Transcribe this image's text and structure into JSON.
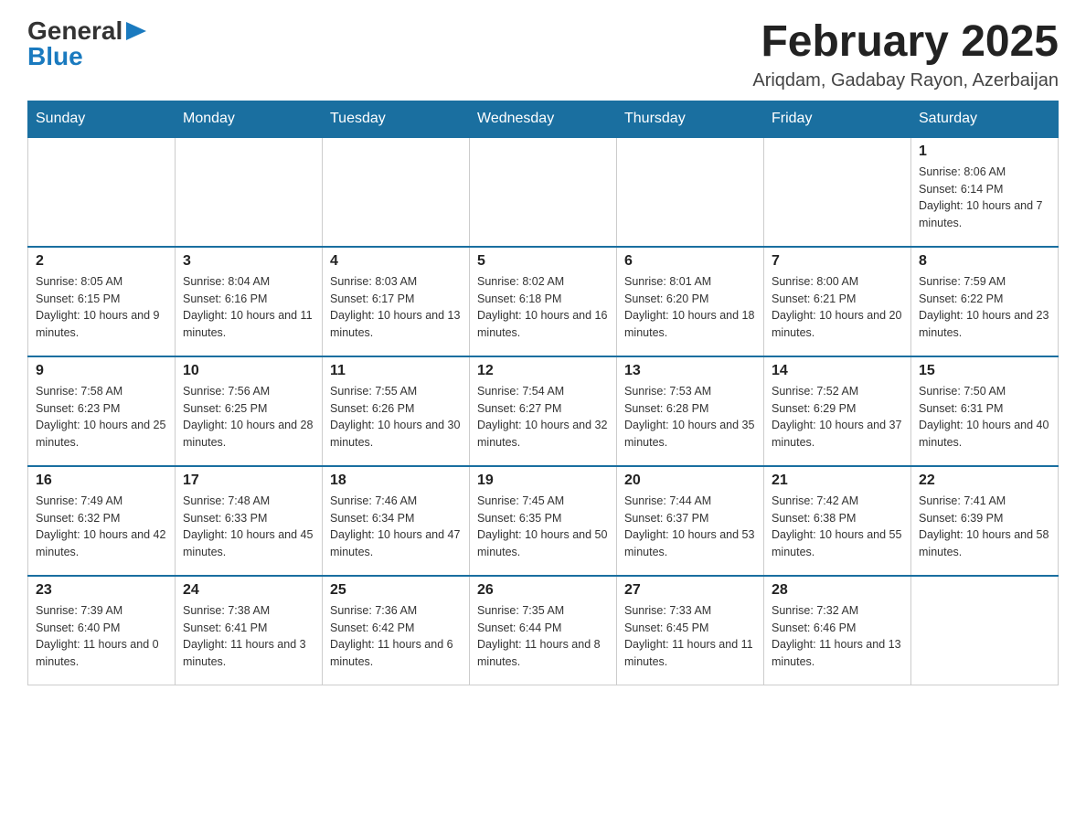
{
  "header": {
    "logo": {
      "general": "General",
      "arrow": "▶",
      "blue": "Blue"
    },
    "title": "February 2025",
    "location": "Ariqdam, Gadabay Rayon, Azerbaijan"
  },
  "weekdays": [
    "Sunday",
    "Monday",
    "Tuesday",
    "Wednesday",
    "Thursday",
    "Friday",
    "Saturday"
  ],
  "weeks": [
    [
      {
        "day": "",
        "info": ""
      },
      {
        "day": "",
        "info": ""
      },
      {
        "day": "",
        "info": ""
      },
      {
        "day": "",
        "info": ""
      },
      {
        "day": "",
        "info": ""
      },
      {
        "day": "",
        "info": ""
      },
      {
        "day": "1",
        "info": "Sunrise: 8:06 AM\nSunset: 6:14 PM\nDaylight: 10 hours and 7 minutes."
      }
    ],
    [
      {
        "day": "2",
        "info": "Sunrise: 8:05 AM\nSunset: 6:15 PM\nDaylight: 10 hours and 9 minutes."
      },
      {
        "day": "3",
        "info": "Sunrise: 8:04 AM\nSunset: 6:16 PM\nDaylight: 10 hours and 11 minutes."
      },
      {
        "day": "4",
        "info": "Sunrise: 8:03 AM\nSunset: 6:17 PM\nDaylight: 10 hours and 13 minutes."
      },
      {
        "day": "5",
        "info": "Sunrise: 8:02 AM\nSunset: 6:18 PM\nDaylight: 10 hours and 16 minutes."
      },
      {
        "day": "6",
        "info": "Sunrise: 8:01 AM\nSunset: 6:20 PM\nDaylight: 10 hours and 18 minutes."
      },
      {
        "day": "7",
        "info": "Sunrise: 8:00 AM\nSunset: 6:21 PM\nDaylight: 10 hours and 20 minutes."
      },
      {
        "day": "8",
        "info": "Sunrise: 7:59 AM\nSunset: 6:22 PM\nDaylight: 10 hours and 23 minutes."
      }
    ],
    [
      {
        "day": "9",
        "info": "Sunrise: 7:58 AM\nSunset: 6:23 PM\nDaylight: 10 hours and 25 minutes."
      },
      {
        "day": "10",
        "info": "Sunrise: 7:56 AM\nSunset: 6:25 PM\nDaylight: 10 hours and 28 minutes."
      },
      {
        "day": "11",
        "info": "Sunrise: 7:55 AM\nSunset: 6:26 PM\nDaylight: 10 hours and 30 minutes."
      },
      {
        "day": "12",
        "info": "Sunrise: 7:54 AM\nSunset: 6:27 PM\nDaylight: 10 hours and 32 minutes."
      },
      {
        "day": "13",
        "info": "Sunrise: 7:53 AM\nSunset: 6:28 PM\nDaylight: 10 hours and 35 minutes."
      },
      {
        "day": "14",
        "info": "Sunrise: 7:52 AM\nSunset: 6:29 PM\nDaylight: 10 hours and 37 minutes."
      },
      {
        "day": "15",
        "info": "Sunrise: 7:50 AM\nSunset: 6:31 PM\nDaylight: 10 hours and 40 minutes."
      }
    ],
    [
      {
        "day": "16",
        "info": "Sunrise: 7:49 AM\nSunset: 6:32 PM\nDaylight: 10 hours and 42 minutes."
      },
      {
        "day": "17",
        "info": "Sunrise: 7:48 AM\nSunset: 6:33 PM\nDaylight: 10 hours and 45 minutes."
      },
      {
        "day": "18",
        "info": "Sunrise: 7:46 AM\nSunset: 6:34 PM\nDaylight: 10 hours and 47 minutes."
      },
      {
        "day": "19",
        "info": "Sunrise: 7:45 AM\nSunset: 6:35 PM\nDaylight: 10 hours and 50 minutes."
      },
      {
        "day": "20",
        "info": "Sunrise: 7:44 AM\nSunset: 6:37 PM\nDaylight: 10 hours and 53 minutes."
      },
      {
        "day": "21",
        "info": "Sunrise: 7:42 AM\nSunset: 6:38 PM\nDaylight: 10 hours and 55 minutes."
      },
      {
        "day": "22",
        "info": "Sunrise: 7:41 AM\nSunset: 6:39 PM\nDaylight: 10 hours and 58 minutes."
      }
    ],
    [
      {
        "day": "23",
        "info": "Sunrise: 7:39 AM\nSunset: 6:40 PM\nDaylight: 11 hours and 0 minutes."
      },
      {
        "day": "24",
        "info": "Sunrise: 7:38 AM\nSunset: 6:41 PM\nDaylight: 11 hours and 3 minutes."
      },
      {
        "day": "25",
        "info": "Sunrise: 7:36 AM\nSunset: 6:42 PM\nDaylight: 11 hours and 6 minutes."
      },
      {
        "day": "26",
        "info": "Sunrise: 7:35 AM\nSunset: 6:44 PM\nDaylight: 11 hours and 8 minutes."
      },
      {
        "day": "27",
        "info": "Sunrise: 7:33 AM\nSunset: 6:45 PM\nDaylight: 11 hours and 11 minutes."
      },
      {
        "day": "28",
        "info": "Sunrise: 7:32 AM\nSunset: 6:46 PM\nDaylight: 11 hours and 13 minutes."
      },
      {
        "day": "",
        "info": ""
      }
    ]
  ]
}
